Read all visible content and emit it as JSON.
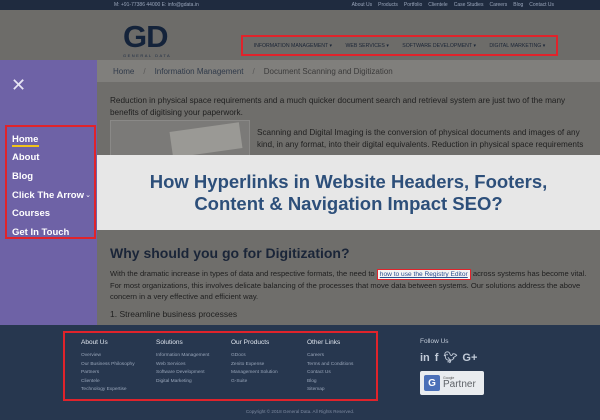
{
  "topbar": {
    "contact": "M: +91-77386 44000   E: info@gdata.in",
    "links": [
      "About Us",
      "Products",
      "Portfolio",
      "Clientele",
      "Case Studies",
      "Careers",
      "Blog",
      "Contact Us"
    ]
  },
  "logo": {
    "mark": "GD",
    "sub": "GENERAL DATA"
  },
  "mainnav": [
    "INFORMATION MANAGEMENT",
    "WEB SERVICES",
    "SOFTWARE DEVELOPMENT",
    "DIGITAL MARKETING"
  ],
  "sidemenu": {
    "close_icon": "close-icon",
    "items": [
      "Home",
      "About",
      "Blog",
      "Click The Arrow",
      "Courses",
      "Get In Touch"
    ]
  },
  "breadcrumb": [
    "Home",
    "Information Management",
    "Document Scanning and Digitization"
  ],
  "intro": "Reduction in physical space requirements and a much quicker document search and retrieval system are just two of the many benefits of digitising your paperwork.",
  "para": "Scanning and Digital Imaging is the conversion of physical documents and images of any kind, in any format, into their digital equivalents. Reduction in physical space requirements",
  "banner": {
    "line1": "How Hyperlinks in Website Headers, Footers,",
    "line2": "Content & Navigation Impact SEO?"
  },
  "section": {
    "heading": "Why should you go for Digitization?",
    "text_before": "With the dramatic increase in types of data and respective formats, the need to",
    "link": "how to use the Registry Editor",
    "text_after": "across systems has become vital. For most organizations, this involves delicate balancing of the processes that move data between systems. Our solutions address the above concern in a very effective and efficient way.",
    "bullet": "1. Streamline business processes"
  },
  "footer": {
    "columns": [
      {
        "title": "About Us",
        "links": [
          "Overview",
          "Our Business Philosophy",
          "Partners",
          "Clientele",
          "Technology Expertise"
        ]
      },
      {
        "title": "Solutions",
        "links": [
          "Information Management",
          "Web Services",
          "Software Development",
          "Digital Marketing"
        ]
      },
      {
        "title": "Our Products",
        "links": [
          "GDocs",
          "Zenito Expense",
          "Management Solution",
          "G-Suite"
        ]
      },
      {
        "title": "Other Links",
        "links": [
          "Careers",
          "Terms and Conditions",
          "Contact Us",
          "Blog",
          "Sitemap"
        ]
      }
    ],
    "follow": "Follow Us",
    "social": [
      "linkedin-icon",
      "facebook-icon",
      "twitter-icon",
      "google-plus-icon"
    ],
    "partner_small": "Google",
    "partner_big": "Partner",
    "copyright": "Copyright © 2018 General Data. All Rights Reserved."
  }
}
